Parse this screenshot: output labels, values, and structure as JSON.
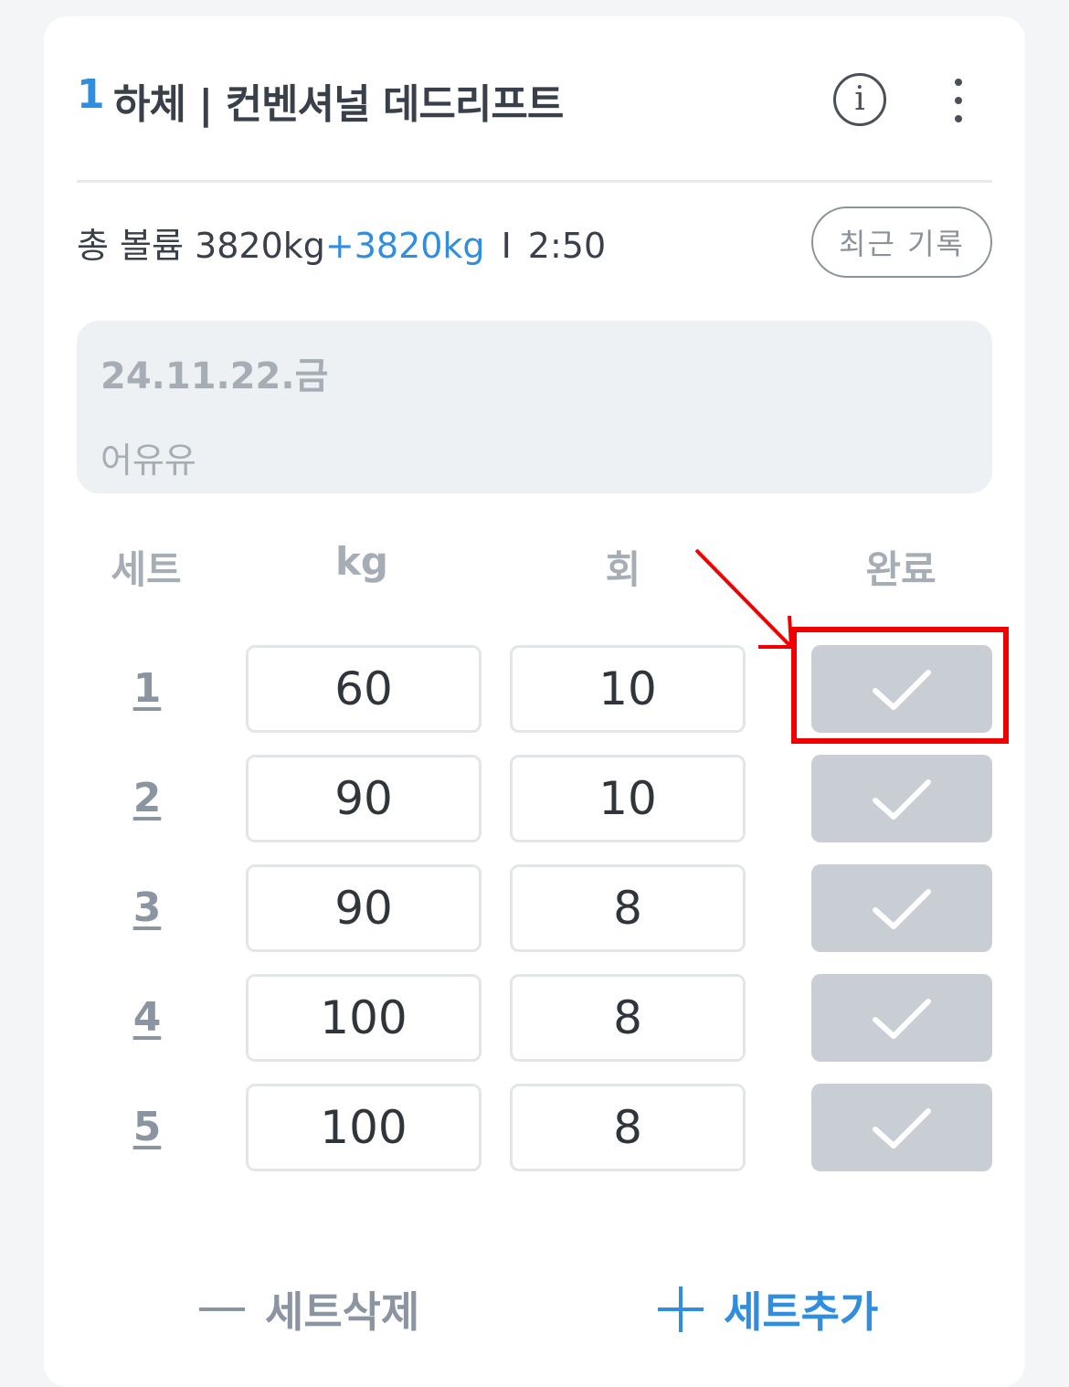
{
  "exercise": {
    "index": "1",
    "title": "하체 | 컨벤셔널 데드리프트",
    "info_icon": "info-icon",
    "more_icon": "more-vertical-icon"
  },
  "summary": {
    "volume_label": "총 볼륨 3820kg",
    "volume_added": "+3820kg",
    "separator": "I",
    "time": "2:50",
    "recent_button": "최근 기록"
  },
  "memo": {
    "date": "24.11.22.금",
    "text": "어유유"
  },
  "table": {
    "headers": [
      "세트",
      "kg",
      "회",
      "완료"
    ],
    "rows": [
      {
        "set": "1",
        "kg": "60",
        "reps": "10"
      },
      {
        "set": "2",
        "kg": "90",
        "reps": "10"
      },
      {
        "set": "3",
        "kg": "90",
        "reps": "8"
      },
      {
        "set": "4",
        "kg": "100",
        "reps": "8"
      },
      {
        "set": "5",
        "kg": "100",
        "reps": "8"
      }
    ],
    "done_icon": "checkmark-icon"
  },
  "footer": {
    "remove_label": "세트삭제",
    "add_label": "세트추가"
  },
  "colors": {
    "accent": "#2f8ee0",
    "highlight": "#f20000",
    "done_button": "#c9ced5"
  }
}
